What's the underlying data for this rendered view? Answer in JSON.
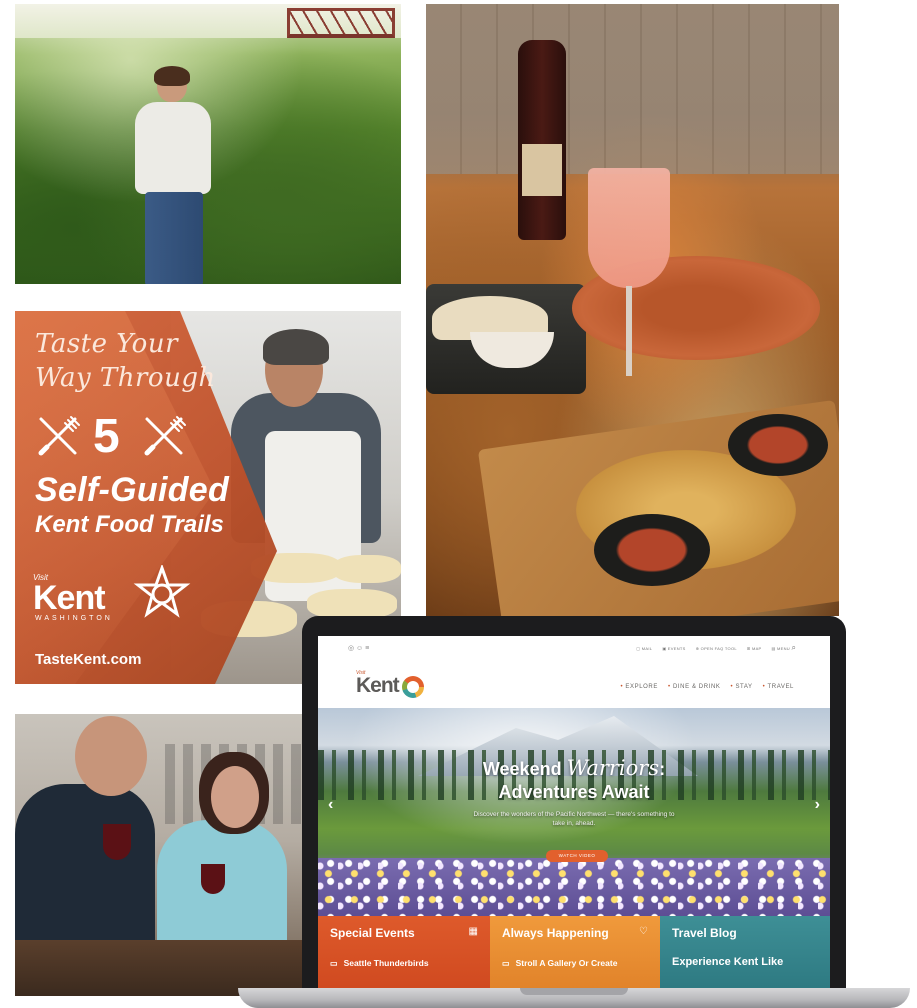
{
  "ad": {
    "script_line1": "Taste Your",
    "script_line2": "Way Through",
    "number": "5",
    "headline": "Self-Guided",
    "subline": "Kent Food Trails",
    "logo_visit": "Visit",
    "logo_name": "Kent",
    "logo_state": "WASHINGTON",
    "url": "TasteKent.com"
  },
  "site": {
    "topbar_icons": "◎ ☺ ≡",
    "topbar_links": [
      "▢ MAIL",
      "▣ EVENTS",
      "⊕ OPEN FAQ TOOL",
      "⊞ MAP",
      "▤ MENU"
    ],
    "search_icon": "search-icon",
    "logo_visit": "Visit",
    "logo_name": "Kent",
    "nav": [
      "EXPLORE",
      "DINE & DRINK",
      "STAY",
      "TRAVEL"
    ]
  },
  "hero": {
    "title_a": "Weekend ",
    "title_script": "Warriors",
    "title_b": ":",
    "title_line2": "Adventures Await",
    "description": "Discover the wonders of the Pacific Northwest — there's something to take in, ahead.",
    "cta": "WATCH VIDEO",
    "prev": "‹",
    "next": "›"
  },
  "tiles": [
    {
      "title": "Special Events",
      "icon": "▦",
      "sub_icon": "▭",
      "sub": "Seattle Thunderbirds",
      "color": "#de5a2b"
    },
    {
      "title": "Always Happening",
      "icon": "♡",
      "sub_icon": "▭",
      "sub": "Stroll A Gallery Or Create",
      "color": "#f09a3c"
    },
    {
      "title": "Travel Blog",
      "icon": "",
      "sub_icon": "",
      "sub": "Experience Kent Like",
      "color": "#3e8f96"
    }
  ]
}
